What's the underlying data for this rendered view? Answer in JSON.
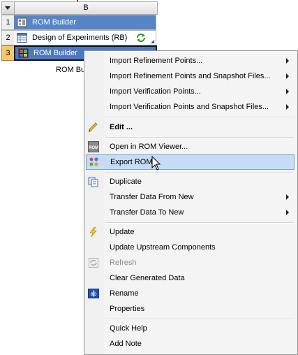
{
  "system": {
    "column": "B",
    "rows": [
      {
        "num": "1",
        "label": "ROM Builder"
      },
      {
        "num": "2",
        "label": "Design of Experiments (RB)"
      },
      {
        "num": "3",
        "label": "ROM Builder"
      }
    ],
    "caption": "ROM Buil"
  },
  "menu": {
    "items": [
      {
        "label": "Import Refinement Points...",
        "submenu": true
      },
      {
        "label": "Import Refinement Points and Snapshot Files...",
        "submenu": true
      },
      {
        "label": "Import Verification Points...",
        "submenu": true
      },
      {
        "label": "Import Verification Points and Snapshot Files...",
        "submenu": true
      },
      {
        "label": "Edit ...",
        "icon": "pencil-icon",
        "bold": true
      },
      {
        "label": "Open in ROM Viewer...",
        "icon": "rom-viewer-icon"
      },
      {
        "label": "Export ROM",
        "icon": "export-rom-icon",
        "highlighted": true
      },
      {
        "label": "Duplicate",
        "icon": "duplicate-icon"
      },
      {
        "label": "Transfer Data From New",
        "submenu": true
      },
      {
        "label": "Transfer Data To New",
        "submenu": true
      },
      {
        "label": "Update",
        "icon": "lightning-icon"
      },
      {
        "label": "Update Upstream Components"
      },
      {
        "label": "Refresh",
        "icon": "refresh-icon",
        "disabled": true
      },
      {
        "label": "Clear Generated Data"
      },
      {
        "label": "Rename",
        "icon": "rename-icon"
      },
      {
        "label": "Properties"
      },
      {
        "label": "Quick Help"
      },
      {
        "label": "Add Note"
      }
    ]
  },
  "colors": {
    "highlight": "#c6dcf4",
    "selected_cell": "#4e78c0",
    "title_cell": "#5585c7"
  }
}
